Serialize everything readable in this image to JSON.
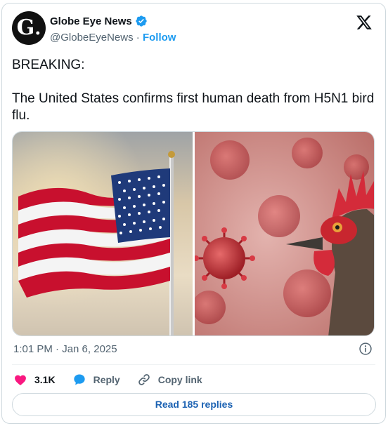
{
  "post": {
    "avatar_letter": "G",
    "display_name": "Globe Eye News",
    "handle": "@GlobeEyeNews",
    "separator": "·",
    "follow_label": "Follow",
    "text": "BREAKING:\n\nThe United States confirms first human death from H5N1 bird flu.",
    "timestamp": "1:01 PM · Jan 6, 2025"
  },
  "actions": {
    "like_count": "3.1K",
    "reply_label": "Reply",
    "copy_link_label": "Copy link"
  },
  "read_replies_label": "Read 185 replies",
  "media": {
    "left_image": "us-flag-photo",
    "right_image": "rooster-virus-photo"
  },
  "colors": {
    "accent": "#1d9bf0",
    "like": "#f91880",
    "text": "#0f1419",
    "muted": "#536471"
  }
}
